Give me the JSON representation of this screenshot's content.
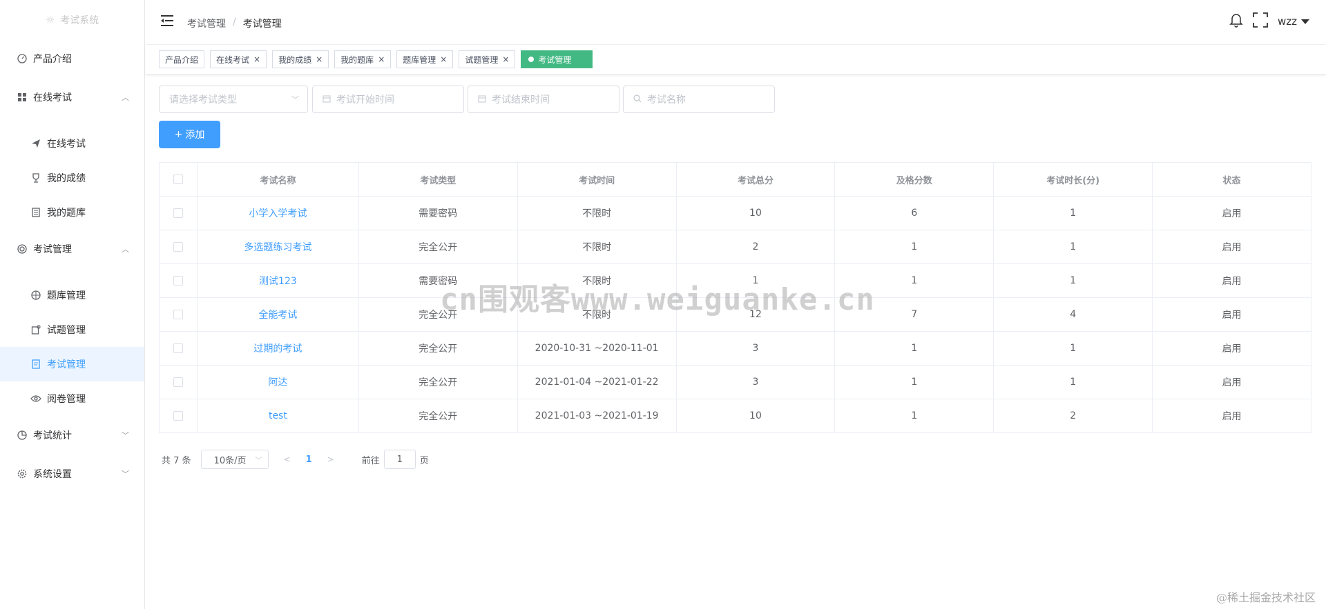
{
  "sidebar": {
    "logo": "考试系统",
    "items": [
      {
        "label": "产品介绍",
        "icon": "gauge-icon"
      },
      {
        "label": "在线考试",
        "icon": "grid-icon"
      },
      {
        "label": "在线考试",
        "icon": "send-icon"
      },
      {
        "label": "我的成绩",
        "icon": "trophy-icon"
      },
      {
        "label": "我的题库",
        "icon": "notebook-icon"
      },
      {
        "label": "考试管理",
        "icon": "ring-icon"
      },
      {
        "label": "题库管理",
        "icon": "crosshair-icon"
      },
      {
        "label": "试题管理",
        "icon": "edit-box-icon"
      },
      {
        "label": "考试管理",
        "icon": "document-icon"
      },
      {
        "label": "阅卷管理",
        "icon": "eye-icon"
      },
      {
        "label": "考试统计",
        "icon": "pie-icon"
      },
      {
        "label": "系统设置",
        "icon": "gear-icon"
      }
    ]
  },
  "header": {
    "breadcrumb": [
      "考试管理",
      "考试管理"
    ],
    "breadcrumb_sep": "/",
    "user": "wzz"
  },
  "tags": [
    {
      "label": "产品介绍"
    },
    {
      "label": "在线考试",
      "close": "×"
    },
    {
      "label": "我的成绩",
      "close": "×"
    },
    {
      "label": "我的题库",
      "close": "×"
    },
    {
      "label": "题库管理",
      "close": "×"
    },
    {
      "label": "试题管理",
      "close": "×"
    },
    {
      "label": "考试管理"
    }
  ],
  "filters": {
    "type_placeholder": "请选择考试类型",
    "start_placeholder": "考试开始时间",
    "end_placeholder": "考试结束时间",
    "name_placeholder": "考试名称"
  },
  "toolbar": {
    "add_label": "添加"
  },
  "table": {
    "columns": [
      "考试名称",
      "考试类型",
      "考试时间",
      "考试总分",
      "及格分数",
      "考试时长(分)",
      "状态"
    ],
    "rows": [
      [
        "小学入学考试",
        "需要密码",
        "不限时",
        "10",
        "6",
        "1",
        "启用"
      ],
      [
        "多选题练习考试",
        "完全公开",
        "不限时",
        "2",
        "1",
        "1",
        "启用"
      ],
      [
        "测试123",
        "需要密码",
        "不限时",
        "1",
        "1",
        "1",
        "启用"
      ],
      [
        "全能考试",
        "完全公开",
        "不限时",
        "12",
        "7",
        "4",
        "启用"
      ],
      [
        "过期的考试",
        "完全公开",
        "2020-10-31 ~2020-11-01",
        "3",
        "1",
        "1",
        "启用"
      ],
      [
        "阿达",
        "完全公开",
        "2021-01-04 ~2021-01-22",
        "3",
        "1",
        "1",
        "启用"
      ],
      [
        "test",
        "完全公开",
        "2021-01-03 ~2021-01-19",
        "10",
        "1",
        "2",
        "启用"
      ]
    ]
  },
  "pagination": {
    "total": "共 7 条",
    "page_size": "10条/页",
    "current": "1",
    "goto_prefix": "前往",
    "goto_value": "1",
    "goto_suffix": "页"
  },
  "watermark": {
    "center": "cn围观客www.weiguanke.cn",
    "corner": "@稀土掘金技术社区"
  },
  "colors": {
    "primary": "#409eff",
    "active_tag": "#42b983",
    "border": "#ebeef5"
  }
}
